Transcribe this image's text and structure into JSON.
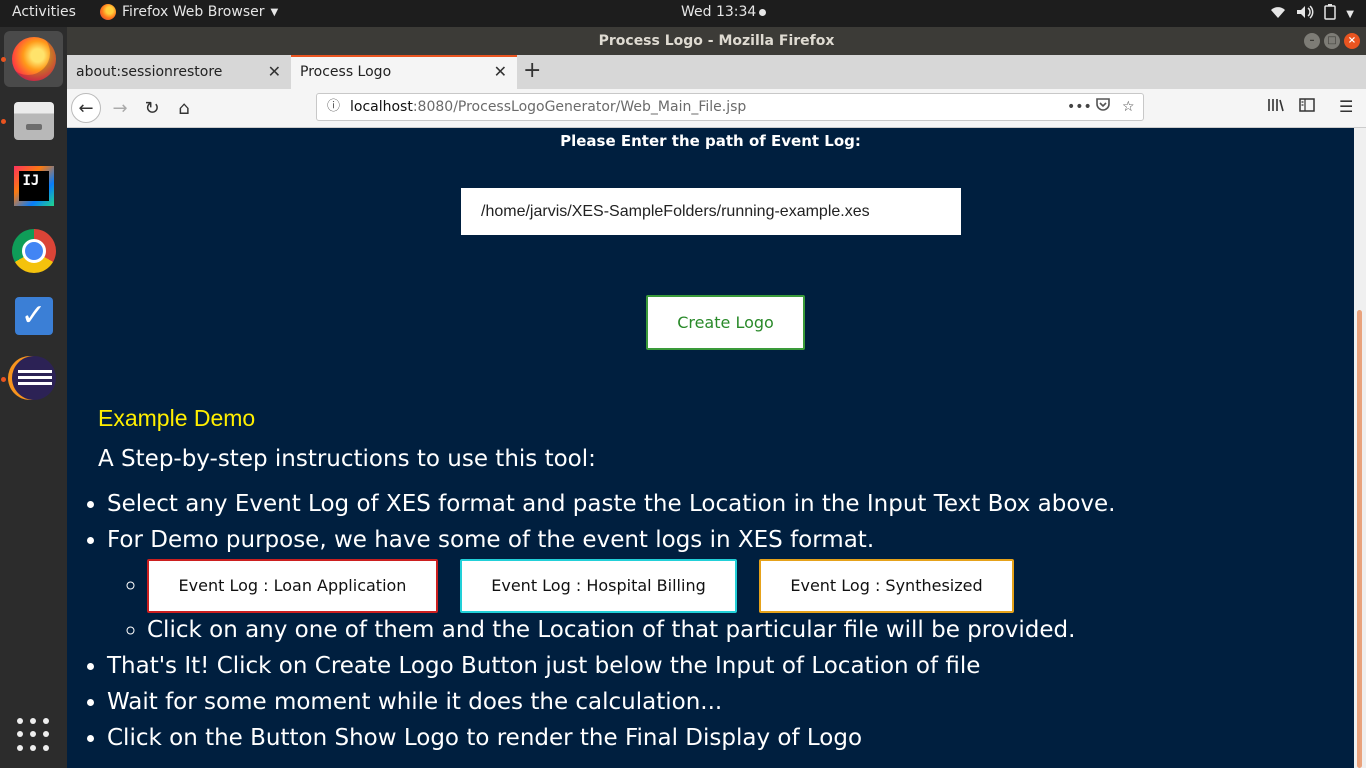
{
  "topbar": {
    "activities": "Activities",
    "app_name": "Firefox Web Browser",
    "clock": "Wed 13:34"
  },
  "dock": {
    "items": [
      "Firefox",
      "Files",
      "IntelliJ IDEA",
      "Google Chrome",
      "To Do",
      "Eclipse",
      "Show Applications"
    ]
  },
  "window": {
    "title": "Process Logo - Mozilla Firefox"
  },
  "tabs": [
    {
      "label": "about:sessionrestore"
    },
    {
      "label": "Process Logo"
    }
  ],
  "navbar": {
    "url_host": "localhost",
    "url_rest": ":8080/ProcessLogoGenerator/Web_Main_File.jsp"
  },
  "page": {
    "prompt": "Please Enter the path of Event Log:",
    "path_value": "/home/jarvis/XES-SampleFolders/running-example.xes",
    "create_label": "Create Logo",
    "demo_title": "Example Demo",
    "instructions_title": "A Step-by-step instructions to use this tool:",
    "steps": [
      "Select any Event Log of XES format and paste the Location in the Input Text Box above.",
      "For Demo purpose, we have some of the event logs in XES format.",
      "That's It! Click on Create Logo Button just below the Input of Location of file",
      "Wait for some moment while it does the calculation...",
      "Click on the Button Show Logo to render the Final Display of Logo"
    ],
    "event_buttons": [
      {
        "label": "Event Log : Loan Application",
        "color": "#cc1f1f"
      },
      {
        "label": "Event Log : Hospital Billing",
        "color": "#22d0d8"
      },
      {
        "label": "Event Log : Synthesized",
        "color": "#e6a21a"
      }
    ],
    "sub_note": "Click on any one of them and the Location of that particular file will be provided."
  },
  "colors": {
    "page_bg": "#001f3f",
    "demo_title": "#ffee00",
    "create_border": "#3a9a3a",
    "ubuntu_accent": "#e95420"
  }
}
